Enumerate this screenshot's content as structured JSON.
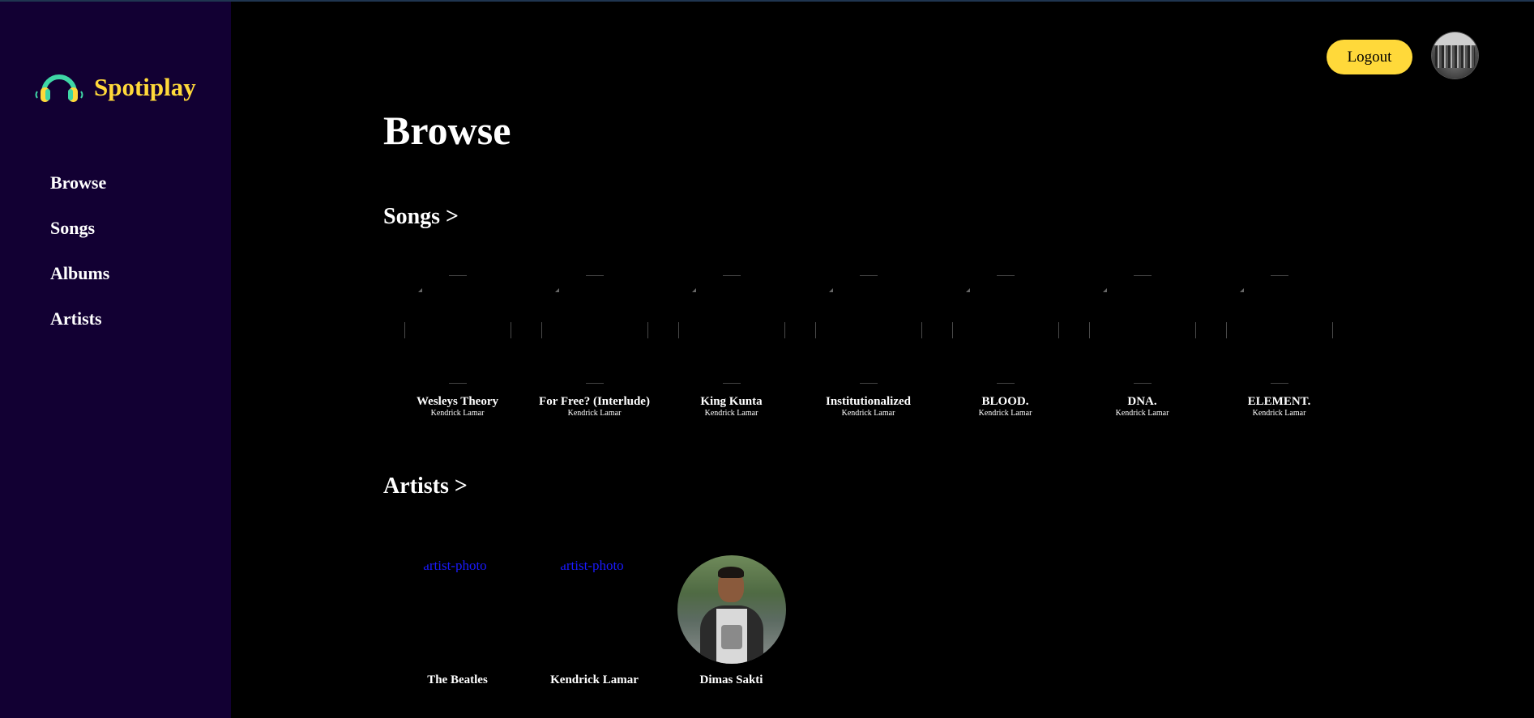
{
  "app": {
    "name": "Spotiplay",
    "accent_color": "#ffd93a",
    "sidebar_color": "#120033",
    "logo_icon": "headphones-icon"
  },
  "sidebar": {
    "items": [
      {
        "label": "Browse"
      },
      {
        "label": "Songs"
      },
      {
        "label": "Albums"
      },
      {
        "label": "Artists"
      }
    ]
  },
  "header": {
    "logout_label": "Logout",
    "avatar_icon": "user-avatar"
  },
  "main": {
    "title": "Browse",
    "songs_section": {
      "title": "Songs >",
      "items": [
        {
          "title": "Wesleys Theory",
          "artist": "Kendrick Lamar"
        },
        {
          "title": "For Free? (Interlude)",
          "artist": "Kendrick Lamar"
        },
        {
          "title": "King Kunta",
          "artist": "Kendrick Lamar"
        },
        {
          "title": "Institutionalized",
          "artist": "Kendrick Lamar"
        },
        {
          "title": "BLOOD.",
          "artist": "Kendrick Lamar"
        },
        {
          "title": "DNA.",
          "artist": "Kendrick Lamar"
        },
        {
          "title": "ELEMENT.",
          "artist": "Kendrick Lamar"
        }
      ]
    },
    "artists_section": {
      "title": "Artists >",
      "items": [
        {
          "name": "The Beatles",
          "photo_alt": "artist-photo",
          "photo_broken": true
        },
        {
          "name": "Kendrick Lamar",
          "photo_alt": "artist-photo",
          "photo_broken": true
        },
        {
          "name": "Dimas Sakti",
          "photo_alt": "artist-photo",
          "photo_broken": false
        }
      ]
    }
  }
}
